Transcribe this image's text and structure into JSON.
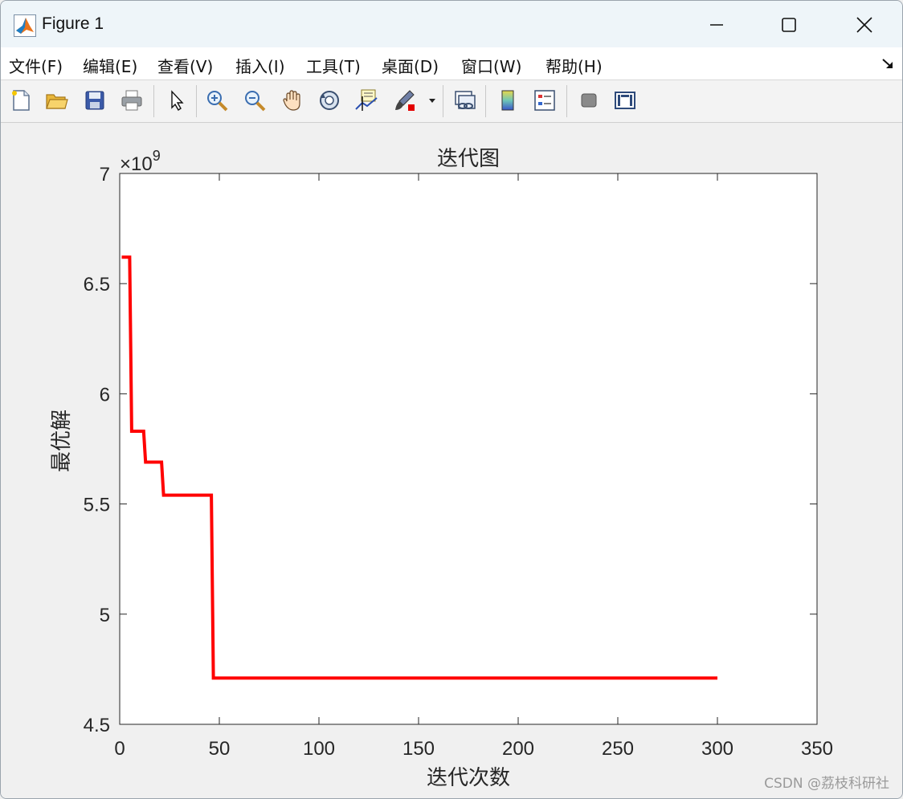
{
  "window": {
    "title": "Figure 1"
  },
  "menu": {
    "items": [
      "文件(F)",
      "编辑(E)",
      "查看(V)",
      "插入(I)",
      "工具(T)",
      "桌面(D)",
      "窗口(W)",
      "帮助(H)"
    ]
  },
  "toolbar": {
    "buttons": [
      "new-figure-icon",
      "open-folder-icon",
      "save-icon",
      "print-icon",
      "pointer-icon",
      "zoom-in-icon",
      "zoom-out-icon",
      "pan-hand-icon",
      "rotate-3d-icon",
      "data-cursor-icon",
      "brush-icon",
      "link-plot-icon",
      "colorbar-icon",
      "legend-icon",
      "hide-plot-tools-icon",
      "show-plot-tools-icon"
    ]
  },
  "colors": {
    "line": "#ff0000",
    "axes_bg": "#ffffff",
    "figure_bg": "#f0f0f0"
  },
  "chart_data": {
    "type": "line",
    "title": "迭代图",
    "xlabel": "迭代次数",
    "ylabel": "最优解",
    "exponent_label": "×10",
    "exponent_power": "9",
    "xlim": [
      0,
      350
    ],
    "ylim": [
      4.5,
      7
    ],
    "xticks": [
      0,
      50,
      100,
      150,
      200,
      250,
      300,
      350
    ],
    "yticks": [
      4.5,
      5,
      5.5,
      6,
      6.5,
      7
    ],
    "ytick_labels": [
      "4.5",
      "5",
      "5.5",
      "6",
      "6.5",
      "7"
    ],
    "xtick_labels": [
      "0",
      "50",
      "100",
      "150",
      "200",
      "250",
      "300",
      "350"
    ],
    "grid": false,
    "series": [
      {
        "x": [
          1,
          5,
          6,
          12,
          13,
          21,
          22,
          46,
          47,
          300
        ],
        "y": [
          6.62,
          6.62,
          5.83,
          5.83,
          5.69,
          5.69,
          5.54,
          5.54,
          4.71,
          4.71
        ]
      }
    ]
  },
  "watermark": "CSDN @荔枝科研社"
}
